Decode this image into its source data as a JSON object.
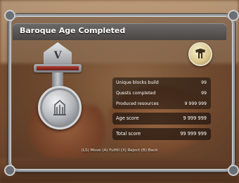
{
  "title": "Baroque Age Completed",
  "medal": {
    "roman_numeral": "V",
    "icon": "medal-icon"
  },
  "emblem": {
    "icon": "guild-emblem-icon"
  },
  "stats": [
    {
      "label": "Unique blocks build",
      "value": "99"
    },
    {
      "label": "Quests completed",
      "value": "99"
    },
    {
      "label": "Produced resources",
      "value": "9 999 999"
    }
  ],
  "age_score": {
    "label": "Age score",
    "value": "9 999 999"
  },
  "total_score": {
    "label": "Total score",
    "value": "99 999 999"
  },
  "controls": "(LS) Move  (A) Fulfill  (X) Reject  (B) Back",
  "colors": {
    "title_bar": "#5a5654",
    "ribbon_red": "#9b2f26",
    "frame": "#9ea2a6"
  }
}
